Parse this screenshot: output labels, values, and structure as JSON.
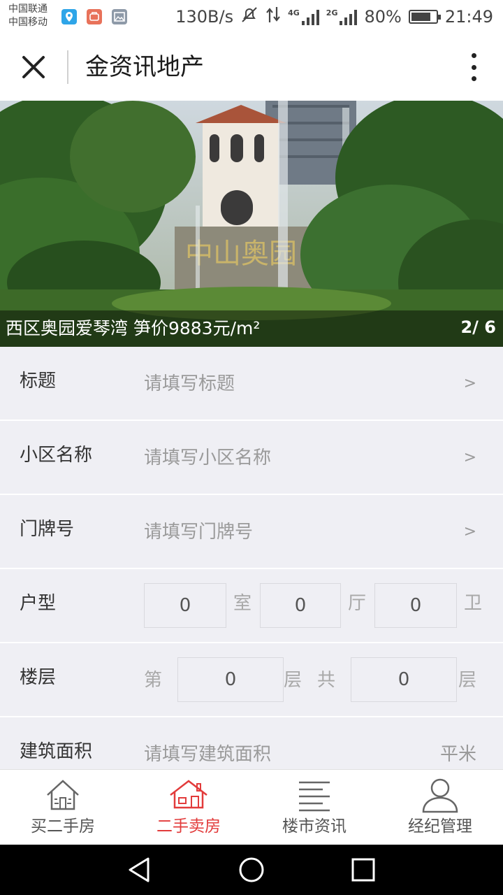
{
  "status_bar": {
    "carrier_1": "中国联通",
    "carrier_2": "中国移动",
    "speed": "130B/s",
    "net_4g": "4G",
    "net_2g": "2G",
    "battery_text": "80%",
    "battery_level": 0.8,
    "time": "21:49"
  },
  "header": {
    "title": "金资讯地产",
    "close_icon": "close-icon",
    "more_icon": "more-vertical-icon"
  },
  "banner": {
    "caption": "西区奥园爱琴湾 笋价9883元/m²",
    "index": "2/ 6"
  },
  "form": {
    "title": {
      "label": "标题",
      "placeholder": "请填写标题",
      "arrow": ">"
    },
    "community": {
      "label": "小区名称",
      "placeholder": "请填写小区名称",
      "arrow": ">"
    },
    "door_number": {
      "label": "门牌号",
      "placeholder": "请填写门牌号",
      "arrow": ">"
    },
    "layout": {
      "label": "户型",
      "rooms": "0",
      "rooms_unit": "室",
      "halls": "0",
      "halls_unit": "厅",
      "baths": "0",
      "baths_unit": "卫"
    },
    "floor": {
      "label": "楼层",
      "prefix": "第",
      "current": "0",
      "mid_unit": "层",
      "total_prefix": "共",
      "total": "0",
      "end_unit": "层"
    },
    "area": {
      "label": "建筑面积",
      "placeholder": "请填写建筑面积",
      "unit": "平米"
    }
  },
  "tabs": [
    {
      "label": "买二手房",
      "icon": "house-icon",
      "active": false
    },
    {
      "label": "二手卖房",
      "icon": "house-sell-icon",
      "active": true
    },
    {
      "label": "楼市资讯",
      "icon": "news-lines-icon",
      "active": false
    },
    {
      "label": "经纪管理",
      "icon": "person-icon",
      "active": false
    }
  ],
  "colors": {
    "accent": "#e23b3b",
    "background": "#efeff4"
  }
}
